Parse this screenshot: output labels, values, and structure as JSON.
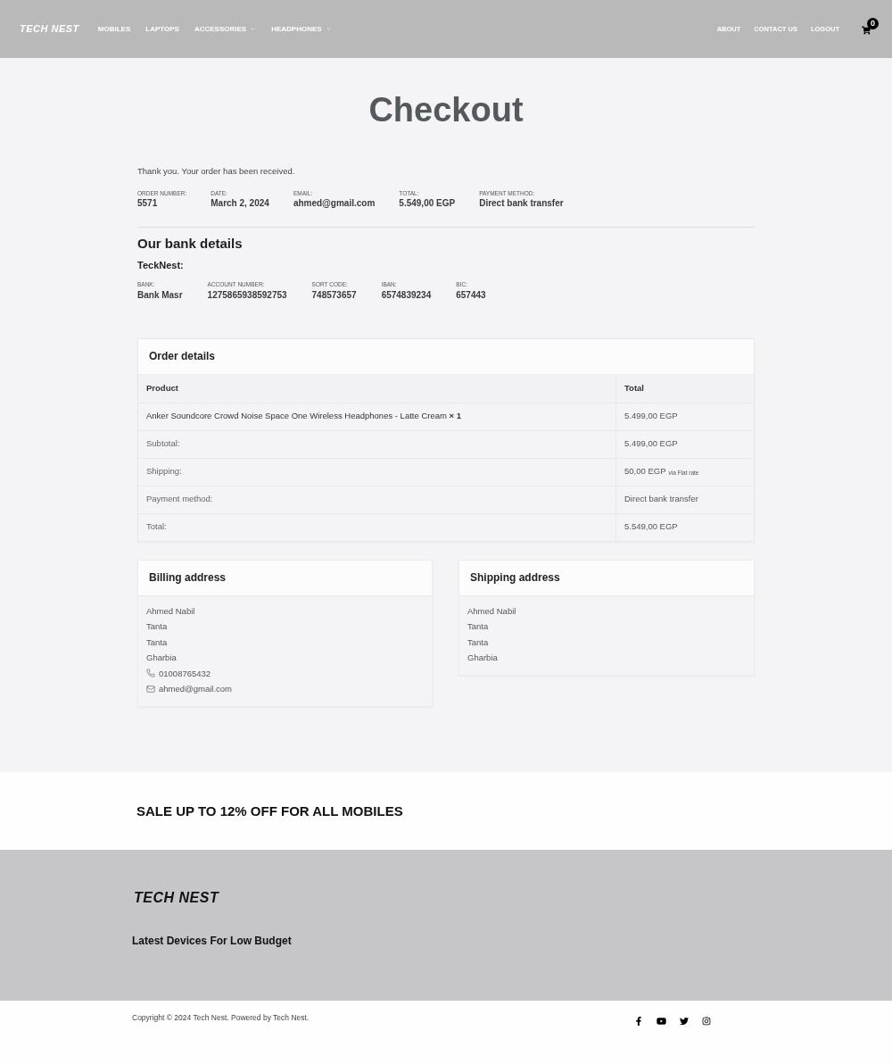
{
  "header": {
    "logo": "TECH NEST",
    "nav": [
      {
        "label": "MOBILES",
        "has_submenu": false
      },
      {
        "label": "LAPTOPS",
        "has_submenu": false
      },
      {
        "label": "ACCESSORIES",
        "has_submenu": true
      },
      {
        "label": "HEADPHONES",
        "has_submenu": true
      }
    ],
    "right_nav": [
      "ABOUT",
      "CONTACT US",
      "LOGOUT"
    ],
    "cart_count": "0"
  },
  "page_title": "Checkout",
  "notice": "Thank you. Your order has been received.",
  "order_overview": [
    {
      "label": "ORDER NUMBER:",
      "value": "5571"
    },
    {
      "label": "DATE:",
      "value": "March 2, 2024"
    },
    {
      "label": "EMAIL:",
      "value": "ahmed@gmail.com"
    },
    {
      "label": "TOTAL:",
      "value": "5.549,00 EGP"
    },
    {
      "label": "PAYMENT METHOD:",
      "value": "Direct bank transfer"
    }
  ],
  "bank_details": {
    "title": "Our bank details",
    "account_name": "TeckNest:",
    "fields": [
      {
        "label": "BANK:",
        "value": "Bank Masr"
      },
      {
        "label": "ACCOUNT NUMBER:",
        "value": "1275865938592753"
      },
      {
        "label": "SORT CODE:",
        "value": "748573657"
      },
      {
        "label": "IBAN:",
        "value": "6574839234"
      },
      {
        "label": "BIC:",
        "value": "657443"
      }
    ]
  },
  "order_details": {
    "title": "Order details",
    "columns": [
      "Product",
      "Total"
    ],
    "rows": [
      {
        "kind": "item",
        "label": "Anker Soundcore Crowd Noise Space One Wireless Headphones - Latte Cream **× 1**",
        "total": "5.499,00 EGP"
      },
      {
        "kind": "summary",
        "label": "Subtotal:",
        "total": "5.499,00 EGP"
      },
      {
        "kind": "summary",
        "label": "Shipping:",
        "total": "50,00 EGP",
        "note": "via Flat rate"
      },
      {
        "kind": "summary",
        "label": "Payment method:",
        "total": "Direct bank transfer"
      },
      {
        "kind": "summary",
        "label": "Total:",
        "total": "5.549,00 EGP"
      }
    ]
  },
  "addresses": [
    {
      "title": "Billing address",
      "lines": [
        "Ahmed Nabil",
        "Tanta",
        "Tanta",
        "Gharbia"
      ],
      "contacts": [
        {
          "kind": "phone",
          "text": "01008765432"
        },
        {
          "kind": "email",
          "text": "ahmed@gmail.com"
        }
      ]
    },
    {
      "title": "Shipping address",
      "lines": [
        "Ahmed Nabil",
        "Tanta",
        "Tanta",
        "Gharbia"
      ]
    }
  ],
  "promo_banner": "SALE UP TO 12% OFF FOR ALL MOBILES",
  "footer": {
    "logo": "TECH NEST",
    "tagline": "Latest Devices For Low Budget",
    "copyright": "Copyright © 2024 Tech Nest. Powered by Tech Nest."
  }
}
